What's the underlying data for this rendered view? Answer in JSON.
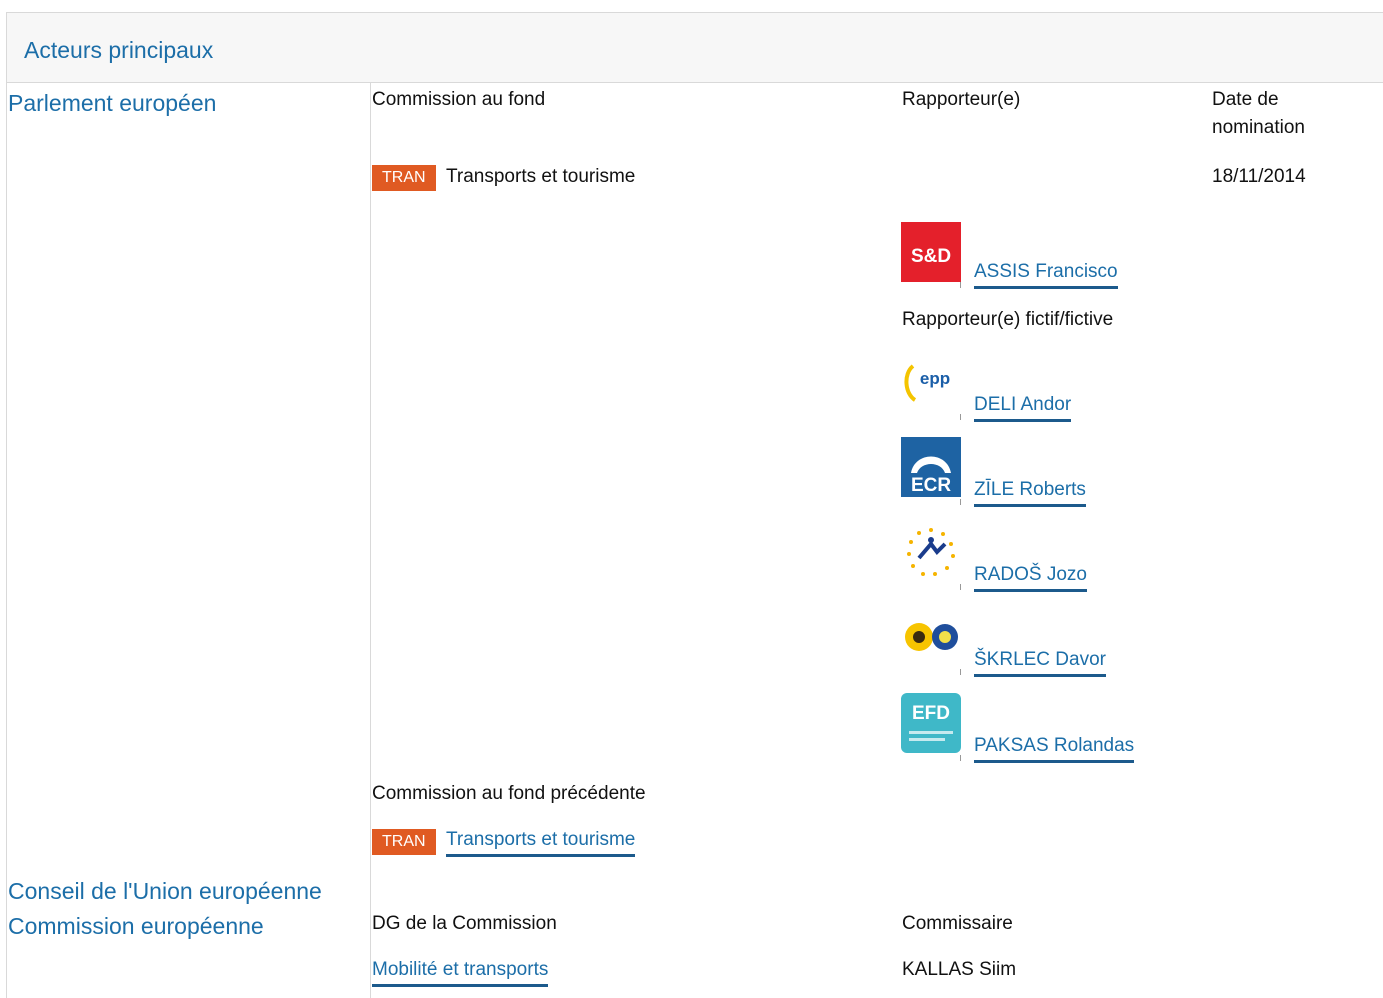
{
  "header": {
    "title": "Acteurs principaux"
  },
  "institutions": {
    "parliament": "Parlement européen",
    "council": "Conseil de l'Union européenne",
    "commission": "Commission européenne"
  },
  "parliament": {
    "col_committee": "Commission au fond",
    "col_rapporteur": "Rapporteur(e)",
    "col_date": "Date de nomination",
    "committee": {
      "code": "TRAN",
      "name": "Transports et tourisme",
      "date": "18/11/2014"
    },
    "rapporteur": {
      "group_logo": "sd-logo",
      "group_logo_text": "S&D",
      "name": "ASSIS Francisco"
    },
    "shadow_label": "Rapporteur(e) fictif/fictive",
    "shadows": [
      {
        "group_logo": "epp-logo",
        "group_logo_text": "epp",
        "name": "DELI Andor"
      },
      {
        "group_logo": "ecr-logo",
        "group_logo_text": "ECR",
        "name": "ZĪLE Roberts"
      },
      {
        "group_logo": "alde-logo",
        "group_logo_text": "",
        "name": "RADOŠ Jozo"
      },
      {
        "group_logo": "greens-efa-logo",
        "group_logo_text": "",
        "name": "ŠKRLEC Davor"
      },
      {
        "group_logo": "efd-logo",
        "group_logo_text": "EFD",
        "name": "PAKSAS Rolandas"
      }
    ],
    "previous_label": "Commission au fond précédente",
    "previous": {
      "code": "TRAN",
      "name": "Transports et tourisme"
    }
  },
  "commission": {
    "col_dg": "DG de la Commission",
    "col_commissioner": "Commissaire",
    "dg": "Mobilité et transports",
    "commissioner": "KALLAS Siim"
  },
  "colors": {
    "accent": "#1c6ea8",
    "badge": "#e05a22",
    "sd_red": "#e4202b",
    "ecr_blue": "#1e63a3",
    "efd_teal": "#3fb8c8"
  }
}
